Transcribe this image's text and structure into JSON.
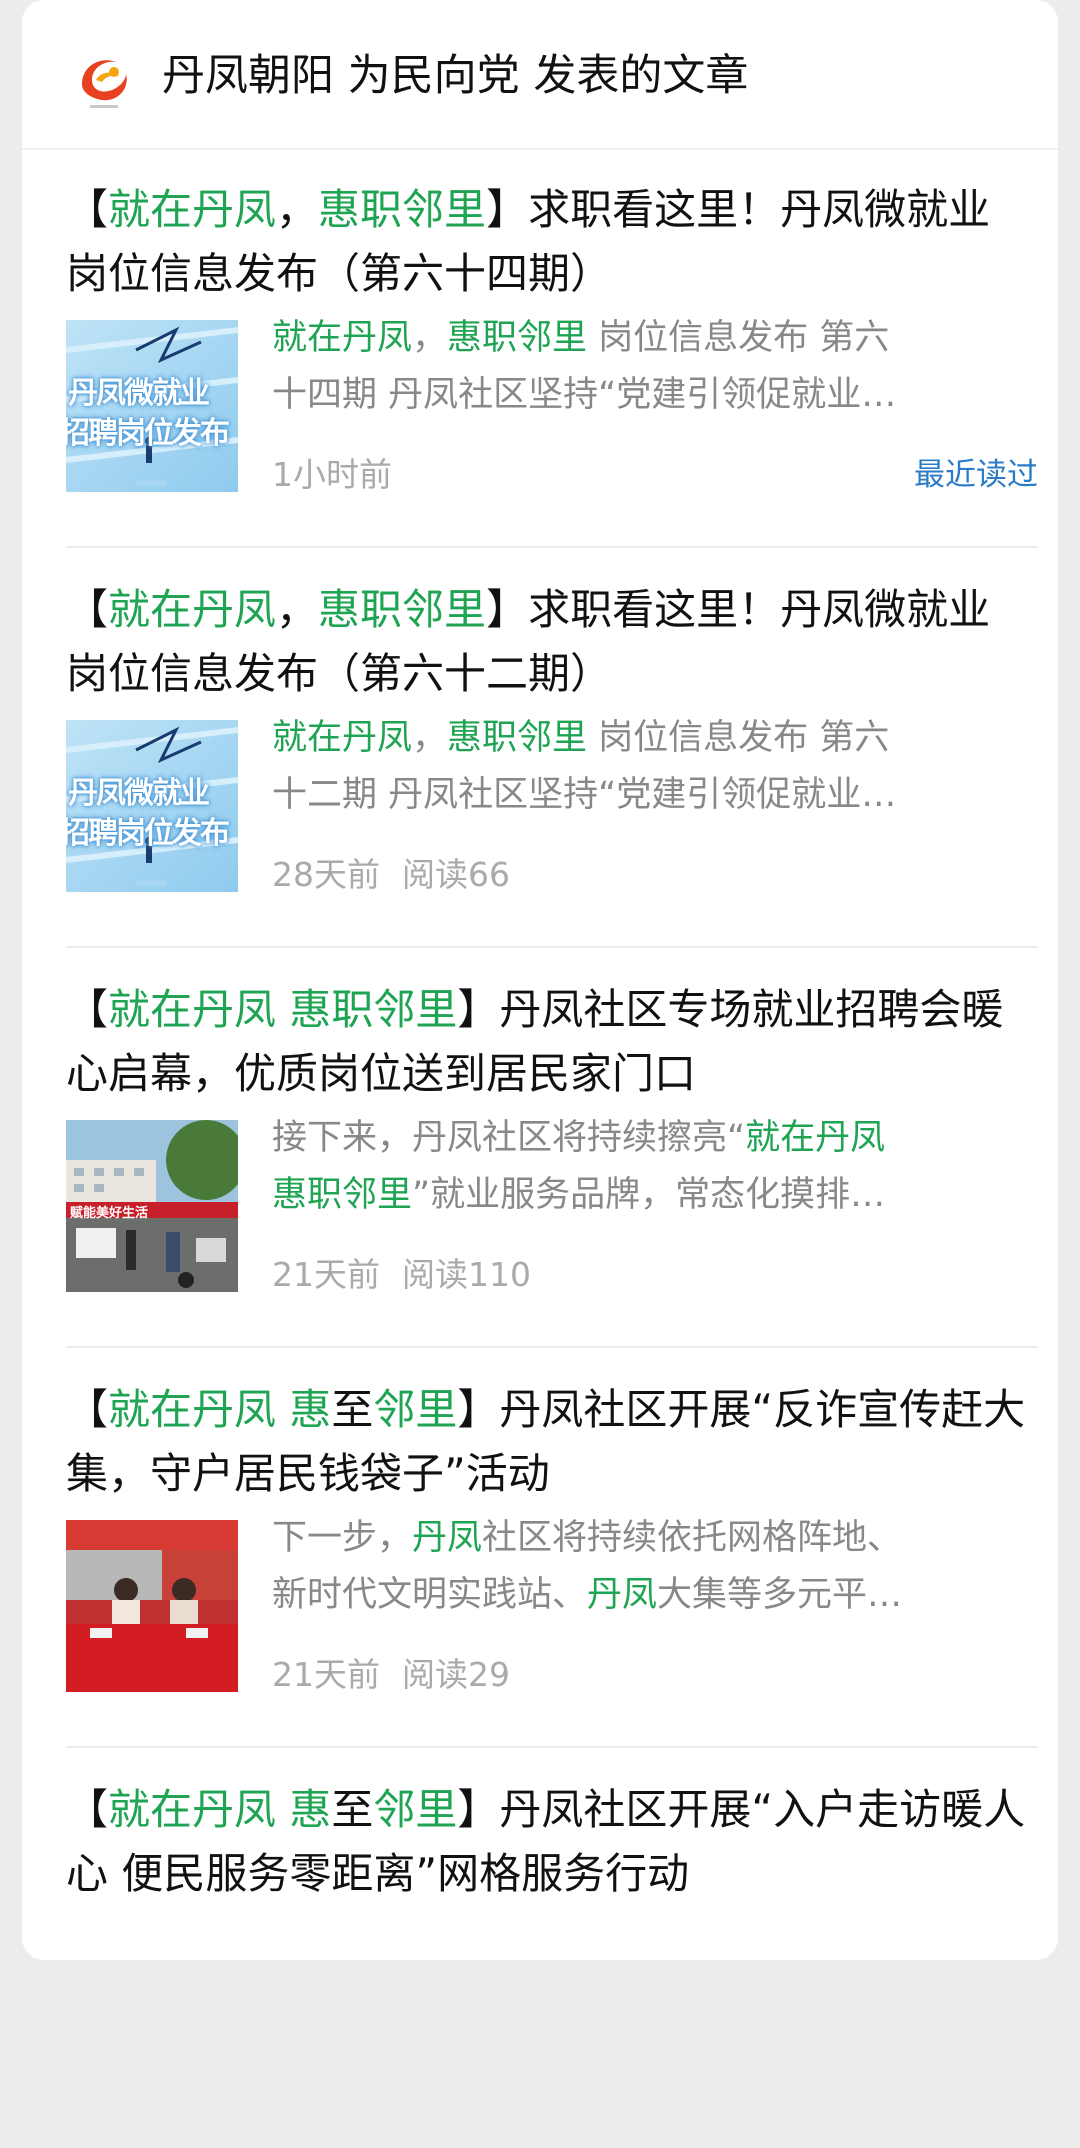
{
  "header": {
    "title": "丹凤朝阳 为民向党 发表的文章"
  },
  "articles": [
    {
      "title_parts": [
        {
          "t": "【",
          "hl": false
        },
        {
          "t": "就在丹凤",
          "hl": true
        },
        {
          "t": "，",
          "hl": false
        },
        {
          "t": "惠职邻里",
          "hl": true
        },
        {
          "t": "】求职看这里！丹凤微就业岗位信息发布（第六十四期）",
          "hl": false
        }
      ],
      "summary_line1": [
        {
          "t": "就在丹凤",
          "hl": true
        },
        {
          "t": "，",
          "hl": false
        },
        {
          "t": "惠职邻里",
          "hl": true
        },
        {
          "t": " 岗位信息发布 第六",
          "hl": false
        }
      ],
      "summary_line2": [
        {
          "t": "十四期 丹凤社区坚持“党建引领促就业…",
          "hl": false
        }
      ],
      "time": "1小时前",
      "reads": "",
      "badge": "最近读过",
      "thumb": "poster",
      "thumb_text1": "丹凤微就业",
      "thumb_text2": "招聘岗位发布"
    },
    {
      "title_parts": [
        {
          "t": "【",
          "hl": false
        },
        {
          "t": "就在丹凤",
          "hl": true
        },
        {
          "t": "，",
          "hl": false
        },
        {
          "t": "惠职邻里",
          "hl": true
        },
        {
          "t": "】求职看这里！丹凤微就业岗位信息发布（第六十二期）",
          "hl": false
        }
      ],
      "summary_line1": [
        {
          "t": "就在丹凤",
          "hl": true
        },
        {
          "t": "，",
          "hl": false
        },
        {
          "t": "惠职邻里",
          "hl": true
        },
        {
          "t": " 岗位信息发布 第六",
          "hl": false
        }
      ],
      "summary_line2": [
        {
          "t": "十二期 丹凤社区坚持“党建引领促就业…",
          "hl": false
        }
      ],
      "time": "28天前",
      "reads": "阅读66",
      "badge": "",
      "thumb": "poster",
      "thumb_text1": "丹凤微就业",
      "thumb_text2": "招聘岗位发布"
    },
    {
      "title_parts": [
        {
          "t": "【",
          "hl": false
        },
        {
          "t": "就在丹凤 惠职邻里",
          "hl": true
        },
        {
          "t": "】丹凤社区专场就业招聘会暖心启幕，优质岗位送到居民家门口",
          "hl": false
        }
      ],
      "summary_line1": [
        {
          "t": "接下来，丹凤社区将持续擦亮“",
          "hl": false
        },
        {
          "t": "就在丹凤",
          "hl": true
        }
      ],
      "summary_line2": [
        {
          "t": "惠职邻里",
          "hl": true
        },
        {
          "t": "”就业服务品牌，常态化摸排…",
          "hl": false
        }
      ],
      "time": "21天前",
      "reads": "阅读110",
      "badge": "",
      "thumb": "fair",
      "thumb_text1": "赋能美好生活",
      "thumb_text2": ""
    },
    {
      "title_parts": [
        {
          "t": "【",
          "hl": false
        },
        {
          "t": "就在丹凤 惠",
          "hl": true
        },
        {
          "t": "至",
          "hl": false
        },
        {
          "t": "邻里",
          "hl": true
        },
        {
          "t": "】丹凤社区开展“反诈宣传赶大集，守户居民钱袋子”活动",
          "hl": false
        }
      ],
      "summary_line1": [
        {
          "t": "下一步，",
          "hl": false
        },
        {
          "t": "丹凤",
          "hl": true
        },
        {
          "t": "社区将持续依托网格阵地、",
          "hl": false
        }
      ],
      "summary_line2": [
        {
          "t": "新时代文明实践站、",
          "hl": false
        },
        {
          "t": "丹凤",
          "hl": true
        },
        {
          "t": "大集等多元平…",
          "hl": false
        }
      ],
      "time": "21天前",
      "reads": "阅读29",
      "badge": "",
      "thumb": "booth",
      "thumb_text1": "",
      "thumb_text2": ""
    },
    {
      "title_parts": [
        {
          "t": "【",
          "hl": false
        },
        {
          "t": "就在丹凤 惠",
          "hl": true
        },
        {
          "t": "至",
          "hl": false
        },
        {
          "t": "邻里",
          "hl": true
        },
        {
          "t": "】丹凤社区开展“入户走访暖人心 便民服务零距离”网格服务行动",
          "hl": false
        }
      ],
      "summary_line1": [],
      "summary_line2": [],
      "time": "",
      "reads": "",
      "badge": "",
      "thumb": "",
      "thumb_text1": "",
      "thumb_text2": ""
    }
  ]
}
